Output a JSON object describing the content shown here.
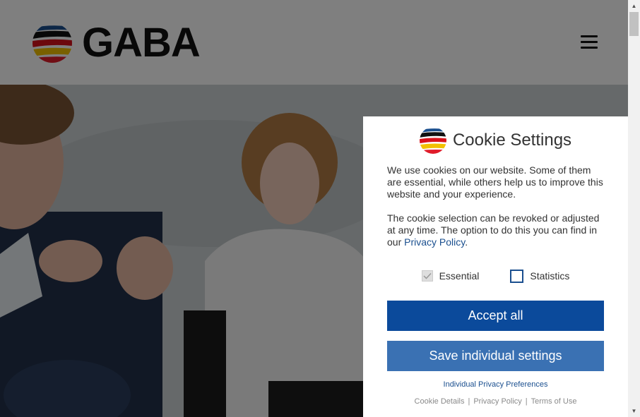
{
  "header": {
    "brand": "GABA",
    "menu_icon": "hamburger-menu-icon"
  },
  "cookie_panel": {
    "title": "Cookie Settings",
    "intro_text": "We use cookies on our website. Some of them are essential, while others help us to improve this website and your experience.",
    "revoke_text": "The cookie selection can be revoked or adjusted at any time. The option to do this you can find in our",
    "privacy_link": "Privacy Policy",
    "revoke_text_end": ".",
    "options": {
      "essential": {
        "label": "Essential",
        "checked": true,
        "disabled": true
      },
      "statistics": {
        "label": "Statistics",
        "checked": false
      }
    },
    "accept_all_label": "Accept all",
    "save_label": "Save individual settings",
    "preferences_link": "Individual Privacy Preferences",
    "footer_links": [
      "Cookie Details",
      "Privacy Policy",
      "Terms of Use"
    ],
    "footer_separator": "|"
  },
  "colors": {
    "primary_button": "#0b4a9b",
    "secondary_button": "#3a71b3",
    "link": "#1a4f8f"
  }
}
